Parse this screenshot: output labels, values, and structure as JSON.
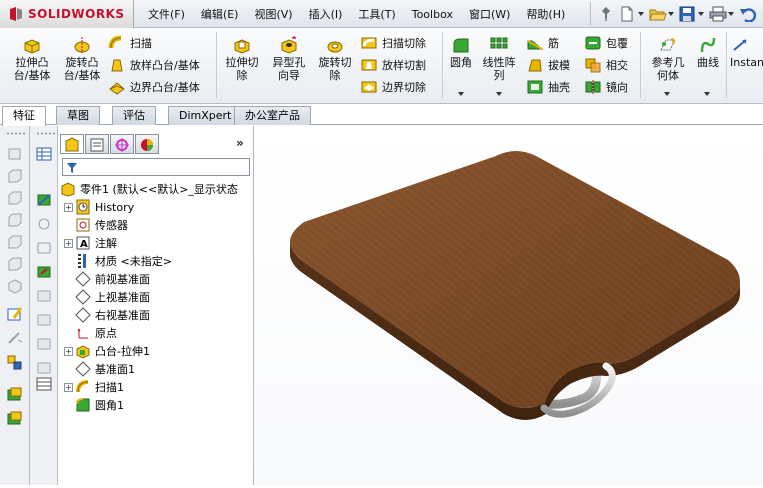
{
  "app": {
    "brand_ds": "DS",
    "brand_name": "SOLIDWORKS"
  },
  "menu": [
    "文件(F)",
    "编辑(E)",
    "视图(V)",
    "插入(I)",
    "工具(T)",
    "Toolbox",
    "窗口(W)",
    "帮助(H)"
  ],
  "quick_icons": [
    "pin-icon",
    "new-document-icon",
    "open-folder-icon",
    "save-icon",
    "print-icon",
    "undo-icon"
  ],
  "ribbon": {
    "extrude_boss": "拉伸凸\n台/基体",
    "revolve_boss": "旋转凸\n台/基体",
    "sweep": "扫描",
    "loft_boss": "放样凸台/基体",
    "boundary_boss": "边界凸台/基体",
    "extrude_cut": "拉伸切\n除",
    "hole_wizard": "异型孔\n向导",
    "revolve_cut": "旋转切\n除",
    "sweep_cut": "扫描切除",
    "loft_cut": "放样切割",
    "boundary_cut": "边界切除",
    "fillet": "圆角",
    "linear_pattern": "线性阵\n列",
    "rib": "筋",
    "draft": "拔模",
    "shell": "抽壳",
    "wrap": "包覆",
    "intersect": "相交",
    "mirror": "镜向",
    "ref_geometry": "参考几\n何体",
    "curves": "曲线",
    "instant3d": "Instan"
  },
  "tabs": [
    "特征",
    "草图",
    "评估",
    "DimXpert",
    "办公室产品"
  ],
  "active_tab": 0,
  "tree": {
    "root": "零件1  (默认<<默认>_显示状态",
    "items": [
      {
        "label": "History",
        "icon": "history-icon",
        "expand": "+"
      },
      {
        "label": "传感器",
        "icon": "sensor-icon",
        "expand": ""
      },
      {
        "label": "注解",
        "icon": "annotation-icon",
        "expand": "+"
      },
      {
        "label": "材质 <未指定>",
        "icon": "material-icon",
        "expand": ""
      },
      {
        "label": "前视基准面",
        "icon": "plane-icon",
        "expand": ""
      },
      {
        "label": "上视基准面",
        "icon": "plane-icon",
        "expand": ""
      },
      {
        "label": "右视基准面",
        "icon": "plane-icon",
        "expand": ""
      },
      {
        "label": "原点",
        "icon": "origin-icon",
        "expand": ""
      },
      {
        "label": "凸台-拉伸1",
        "icon": "extrude-feature-icon",
        "expand": "+"
      },
      {
        "label": "基准面1",
        "icon": "plane-icon",
        "expand": ""
      },
      {
        "label": "扫描1",
        "icon": "sweep-feature-icon",
        "expand": "+"
      },
      {
        "label": "圆角1",
        "icon": "fillet-feature-icon",
        "expand": ""
      }
    ]
  },
  "model": {
    "description": "wooden cutting board with metal handle",
    "wood_color": "#7a4a26",
    "handle_color": "#c8c8c8"
  },
  "colors": {
    "brand_red": "#c8102e",
    "toolbar_yellow": "#e8b400",
    "toolbar_green": "#3aa635"
  }
}
